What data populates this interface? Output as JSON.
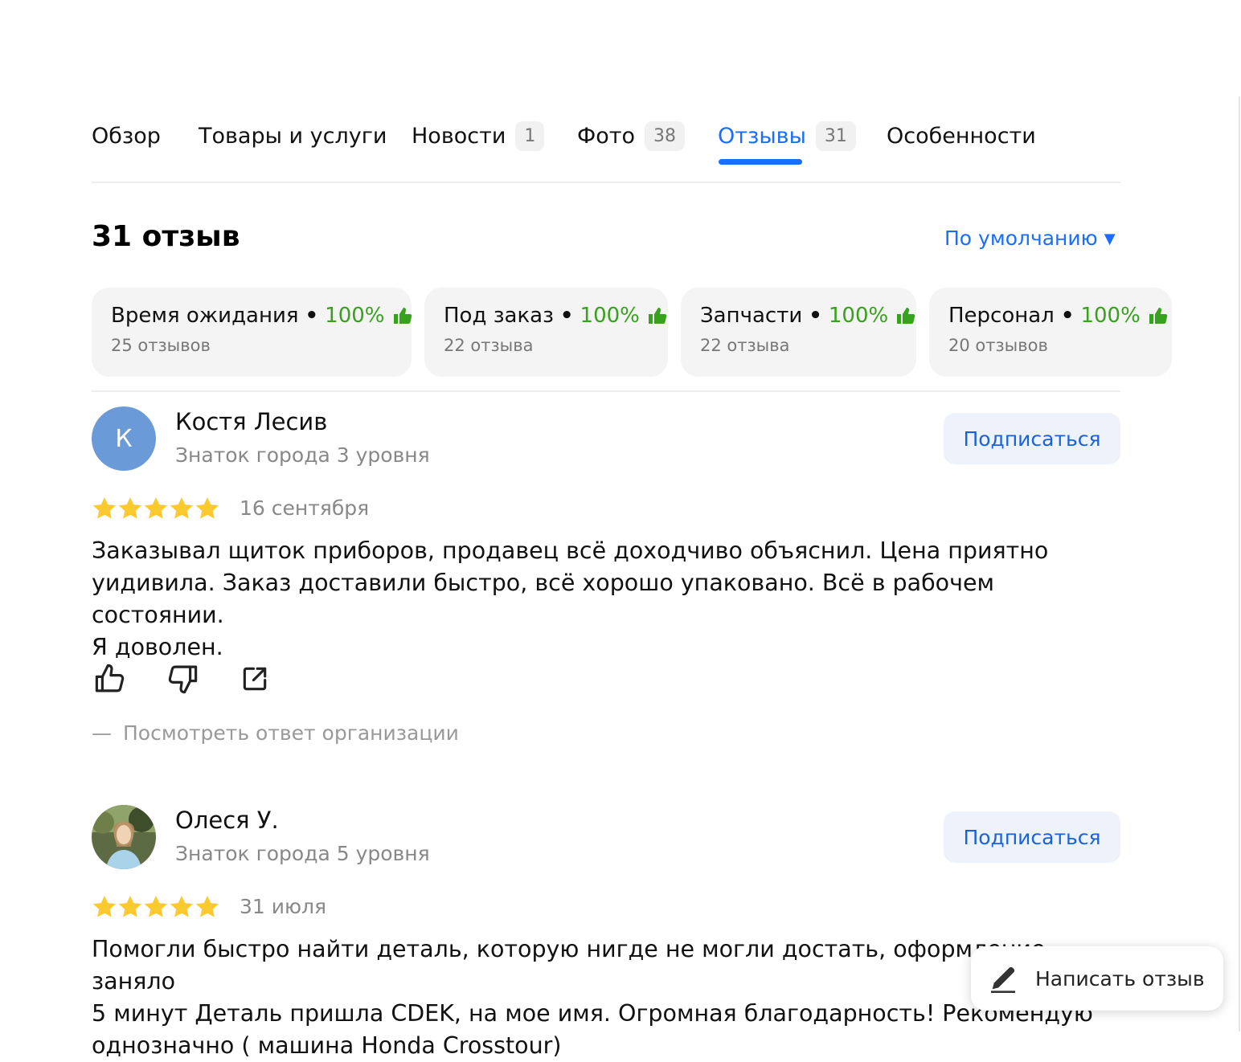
{
  "tabs": [
    {
      "label": "Обзор",
      "count": ""
    },
    {
      "label": "Товары и услуги",
      "count": ""
    },
    {
      "label": "Новости",
      "count": "1"
    },
    {
      "label": "Фото",
      "count": "38"
    },
    {
      "label": "Отзывы",
      "count": "31"
    },
    {
      "label": "Особенности",
      "count": ""
    }
  ],
  "active_tab": "Отзывы",
  "reviews_header": {
    "title": "31 отзыв",
    "sort_label": "По умолчанию",
    "sort_arrow": "▼"
  },
  "aspects": [
    {
      "name": "Время ожидания",
      "dot": "•",
      "percent": "100%",
      "count": "25 отзывов"
    },
    {
      "name": "Под заказ",
      "dot": "•",
      "percent": "100%",
      "count": "22 отзыва"
    },
    {
      "name": "Запчасти",
      "dot": "•",
      "percent": "100%",
      "count": "22 отзыва"
    },
    {
      "name": "Персонал",
      "dot": "•",
      "percent": "100%",
      "count": "20 отзывов"
    }
  ],
  "reviews": [
    {
      "avatar_letter": "К",
      "author": "Костя Лесив",
      "level": "Знаток города 3 уровня",
      "subscribe_label": "Подписаться",
      "rating": 5,
      "date": "16 сентября",
      "text_lines": [
        "Заказывал щиток приборов, продавец всё доходчиво объяснил. Цена приятно",
        "уидивила. Заказ доставили быстро, всё хорошо упаковано. Всё в рабочем состоянии.",
        "Я доволен."
      ],
      "org_reply_label": "Посмотреть ответ организации",
      "org_reply_dash": "—"
    },
    {
      "avatar_letter": "",
      "author": "Олеся У.",
      "level": "Знаток города 5 уровня",
      "subscribe_label": "Подписаться",
      "rating": 5,
      "date": "31 июля",
      "text_lines": [
        "Помогли быстро найти деталь, которую нигде не могли достать, оформление заняло",
        "5 минут Деталь пришла CDEK, на мое имя. Огромная благодарность! Рекомендую",
        "однозначно ( машина Honda Crosstour)"
      ]
    }
  ],
  "write_review": {
    "label": "Написать отзыв"
  },
  "colors": {
    "accent": "#196dff",
    "positive": "#37a21b",
    "star": "#fcc931",
    "muted": "#888888"
  },
  "icons": {
    "like": "thumb-up-icon",
    "dislike": "thumb-down-icon",
    "share": "share-icon",
    "write": "pencil-icon",
    "aspect": "thumb-up-icon",
    "star": "star-icon"
  }
}
